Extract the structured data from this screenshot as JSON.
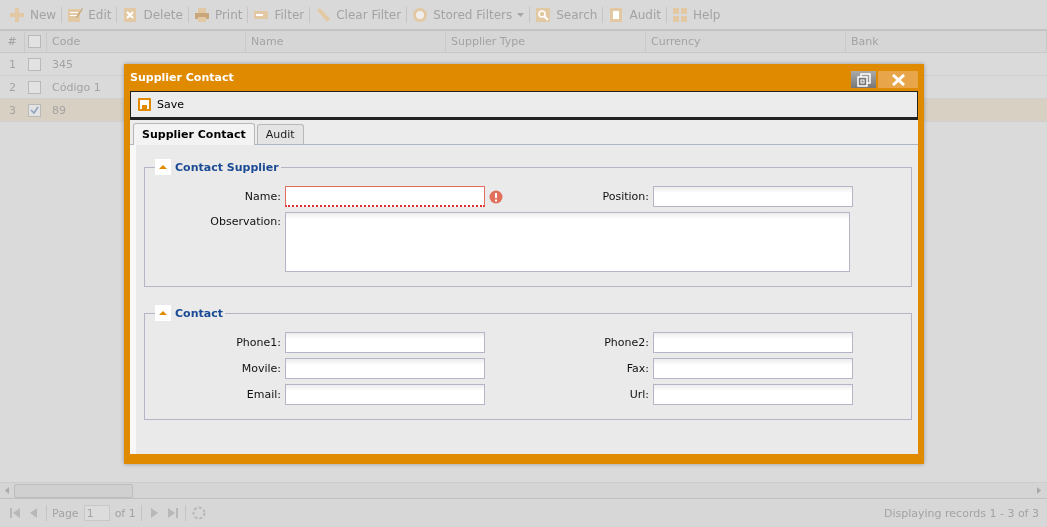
{
  "toolbar": [
    {
      "label": "New",
      "has_menu": false
    },
    {
      "label": "Edit",
      "has_menu": false
    },
    {
      "label": "Delete",
      "has_menu": false
    },
    {
      "label": "Print",
      "has_menu": false
    },
    {
      "label": "Filter",
      "has_menu": false
    },
    {
      "label": "Clear Filter",
      "has_menu": false
    },
    {
      "label": "Stored Filters",
      "has_menu": true
    },
    {
      "label": "Search",
      "has_menu": false
    },
    {
      "label": "Audit",
      "has_menu": false
    },
    {
      "label": "Help",
      "has_menu": false
    }
  ],
  "grid": {
    "columns": [
      "#",
      "Code",
      "Name",
      "Supplier Type",
      "Currency",
      "Bank"
    ],
    "header_checked": false,
    "rows": [
      {
        "number": "1",
        "checked": false,
        "selected": false,
        "code": "345"
      },
      {
        "number": "2",
        "checked": false,
        "selected": false,
        "code": "Código 1"
      },
      {
        "number": "3",
        "checked": true,
        "selected": true,
        "code": "89"
      }
    ]
  },
  "paging": {
    "page_label": "Page",
    "page": "1",
    "of_label": "of 1",
    "status": "Displaying records 1 - 3 of 3"
  },
  "dialog": {
    "title": "Supplier Contact",
    "save": "Save",
    "tabs": [
      {
        "label": "Supplier Contact",
        "selected": true
      },
      {
        "label": "Audit",
        "selected": false
      }
    ],
    "sections": [
      {
        "title": "Contact Supplier",
        "expanded": true,
        "fields": [
          {
            "label": "Name:",
            "kind": "text",
            "invalid": true
          },
          {
            "label": "Position:",
            "kind": "text",
            "invalid": false
          },
          {
            "label": "Observation:",
            "kind": "textarea",
            "invalid": false
          }
        ]
      },
      {
        "title": "Contact",
        "expanded": true,
        "fields": [
          {
            "label": "Phone1:",
            "kind": "text",
            "invalid": false
          },
          {
            "label": "Phone2:",
            "kind": "text",
            "invalid": false
          },
          {
            "label": "Movile:",
            "kind": "text",
            "invalid": false
          },
          {
            "label": "Fax:",
            "kind": "text",
            "invalid": false
          },
          {
            "label": "Email:",
            "kind": "text",
            "invalid": false
          },
          {
            "label": "Url:",
            "kind": "text",
            "invalid": false
          }
        ]
      }
    ]
  }
}
